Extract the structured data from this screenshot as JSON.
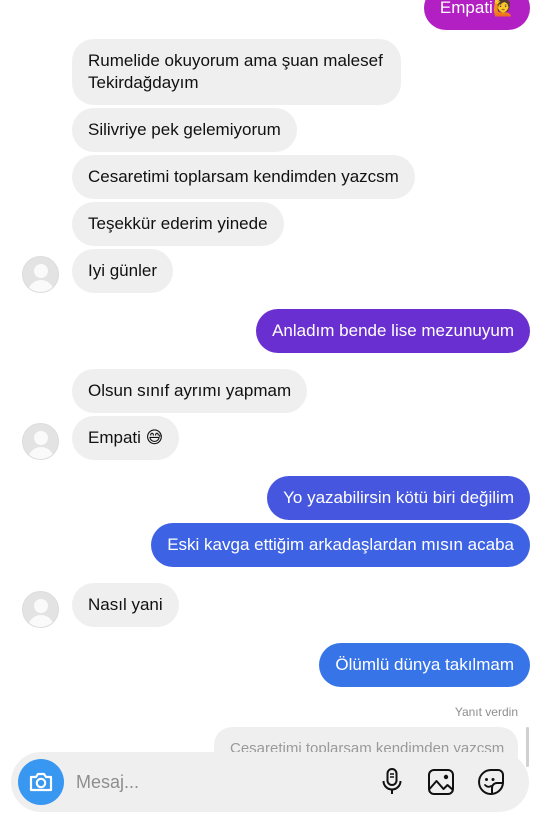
{
  "messages": [
    {
      "side": "out",
      "text": "Empati🙋"
    },
    {
      "side": "in",
      "text": "Rumelide okuyorum ama şuan malesef Tekirdağdayım"
    },
    {
      "side": "in",
      "text": "Silivriye pek gelemiyorum"
    },
    {
      "side": "in",
      "text": "Cesaretimi toplarsam kendimden yazcsm"
    },
    {
      "side": "in",
      "text": "Teşekkür ederim yinede"
    },
    {
      "side": "in",
      "text": "Iyi günler"
    },
    {
      "side": "out",
      "text": "Anladım bende lise mezunuyum"
    },
    {
      "side": "in",
      "text": "Olsun sınıf ayrımı yapmam"
    },
    {
      "side": "in",
      "text": "Empati 😅"
    },
    {
      "side": "out",
      "text": "Yo yazabilirsin kötü biri değilim"
    },
    {
      "side": "out",
      "text": "Eski kavga ettiğim arkadaşlardan mısın acaba"
    },
    {
      "side": "in",
      "text": "Nasıl yani"
    },
    {
      "side": "out",
      "text": "Ölümlü dünya takılmam"
    }
  ],
  "reply_status": "Yanıt verdin",
  "reply_preview": "Cesaretimi toplarsam kendimden yazcsm",
  "composer": {
    "placeholder": "Mesaj...",
    "value": ""
  },
  "icons": {
    "camera": "camera-icon",
    "microphone": "microphone-icon",
    "gallery": "gallery-icon",
    "sticker": "sticker-icon",
    "avatar": "default-avatar-icon"
  },
  "colors": {
    "incoming_bubble": "#efefef",
    "out_purple": "#7d2fc8",
    "out_indigo": "#5b3fd9",
    "out_blue_violet": "#4656df",
    "out_blue": "#3d63e4",
    "out_light_blue": "#3774e8",
    "camera_button": "#3897f0"
  }
}
